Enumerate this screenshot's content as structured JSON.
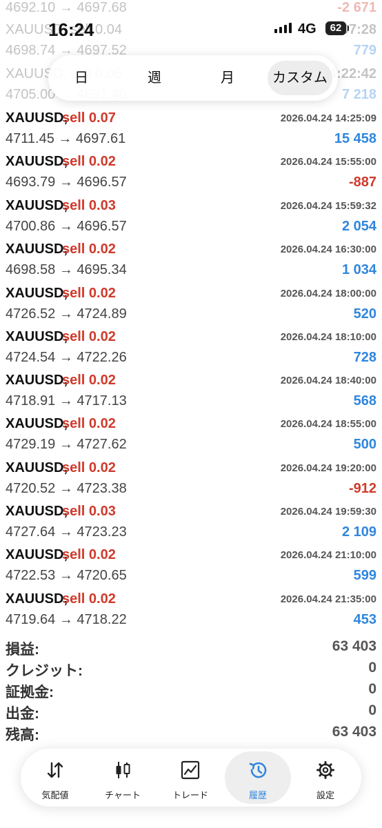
{
  "status_bar": {
    "time": "16:24",
    "network": "4G",
    "battery": "62"
  },
  "background_rows": [
    {
      "left": "4692.10 → 4697.68",
      "right": "-2 671",
      "right_color": "#cf3a2c"
    },
    {
      "left": "XAUUSD, sell 0.04",
      "right": "07:28",
      "right_color": "#555555"
    },
    {
      "left": "4698.74 → 4697.52",
      "right": "779",
      "right_color": "#2f86de"
    },
    {
      "left": "XAUUSD, sell 0.06",
      "right": "14:22:42",
      "right_color": "#555555"
    },
    {
      "left": "4705.00 → 4691.40",
      "right": "7 218",
      "right_color": "#2f86de"
    }
  ],
  "period_tabs": [
    {
      "label": "日",
      "selected": false
    },
    {
      "label": "週",
      "selected": false
    },
    {
      "label": "月",
      "selected": false
    },
    {
      "label": "カスタム",
      "selected": true
    }
  ],
  "trades": [
    {
      "symbol": "XAUUSD,",
      "action": "sell 0.07",
      "datetime": "2026.04.24 14:25:09",
      "prices": "4711.45 → 4697.61",
      "profit": "15 458",
      "profit_sign": "positive"
    },
    {
      "symbol": "XAUUSD,",
      "action": "sell 0.02",
      "datetime": "2026.04.24 15:55:00",
      "prices": "4693.79 → 4696.57",
      "profit": "-887",
      "profit_sign": "negative"
    },
    {
      "symbol": "XAUUSD,",
      "action": "sell 0.03",
      "datetime": "2026.04.24 15:59:32",
      "prices": "4700.86 → 4696.57",
      "profit": "2 054",
      "profit_sign": "positive"
    },
    {
      "symbol": "XAUUSD,",
      "action": "sell 0.02",
      "datetime": "2026.04.24 16:30:00",
      "prices": "4698.58 → 4695.34",
      "profit": "1 034",
      "profit_sign": "positive"
    },
    {
      "symbol": "XAUUSD,",
      "action": "sell 0.02",
      "datetime": "2026.04.24 18:00:00",
      "prices": "4726.52 → 4724.89",
      "profit": "520",
      "profit_sign": "positive"
    },
    {
      "symbol": "XAUUSD,",
      "action": "sell 0.02",
      "datetime": "2026.04.24 18:10:00",
      "prices": "4724.54 → 4722.26",
      "profit": "728",
      "profit_sign": "positive"
    },
    {
      "symbol": "XAUUSD,",
      "action": "sell 0.02",
      "datetime": "2026.04.24 18:40:00",
      "prices": "4718.91 → 4717.13",
      "profit": "568",
      "profit_sign": "positive"
    },
    {
      "symbol": "XAUUSD,",
      "action": "sell 0.02",
      "datetime": "2026.04.24 18:55:00",
      "prices": "4729.19 → 4727.62",
      "profit": "500",
      "profit_sign": "positive"
    },
    {
      "symbol": "XAUUSD,",
      "action": "sell 0.02",
      "datetime": "2026.04.24 19:20:00",
      "prices": "4720.52 → 4723.38",
      "profit": "-912",
      "profit_sign": "negative"
    },
    {
      "symbol": "XAUUSD,",
      "action": "sell 0.03",
      "datetime": "2026.04.24 19:59:30",
      "prices": "4727.64 → 4723.23",
      "profit": "2 109",
      "profit_sign": "positive"
    },
    {
      "symbol": "XAUUSD,",
      "action": "sell 0.02",
      "datetime": "2026.04.24 21:10:00",
      "prices": "4722.53 → 4720.65",
      "profit": "599",
      "profit_sign": "positive"
    },
    {
      "symbol": "XAUUSD,",
      "action": "sell 0.02",
      "datetime": "2026.04.24 21:35:00",
      "prices": "4719.64 → 4718.22",
      "profit": "453",
      "profit_sign": "positive"
    }
  ],
  "summary": [
    {
      "label": "損益:",
      "value": "63 403"
    },
    {
      "label": "クレジット:",
      "value": "0"
    },
    {
      "label": "証拠金:",
      "value": "0"
    },
    {
      "label": "出金:",
      "value": "0"
    },
    {
      "label": "残高:",
      "value": "63 403"
    }
  ],
  "nav": [
    {
      "label": "気配値",
      "icon": "quotes-arrows-icon",
      "active": false
    },
    {
      "label": "チャート",
      "icon": "candlestick-chart-icon",
      "active": false
    },
    {
      "label": "トレード",
      "icon": "trade-chart-icon",
      "active": false
    },
    {
      "label": "履歴",
      "icon": "history-clock-icon",
      "active": true
    },
    {
      "label": "設定",
      "icon": "gear-icon",
      "active": false
    }
  ],
  "colors": {
    "positive": "#2f86de",
    "negative": "#cf3a2c",
    "accent": "#2f86de"
  }
}
